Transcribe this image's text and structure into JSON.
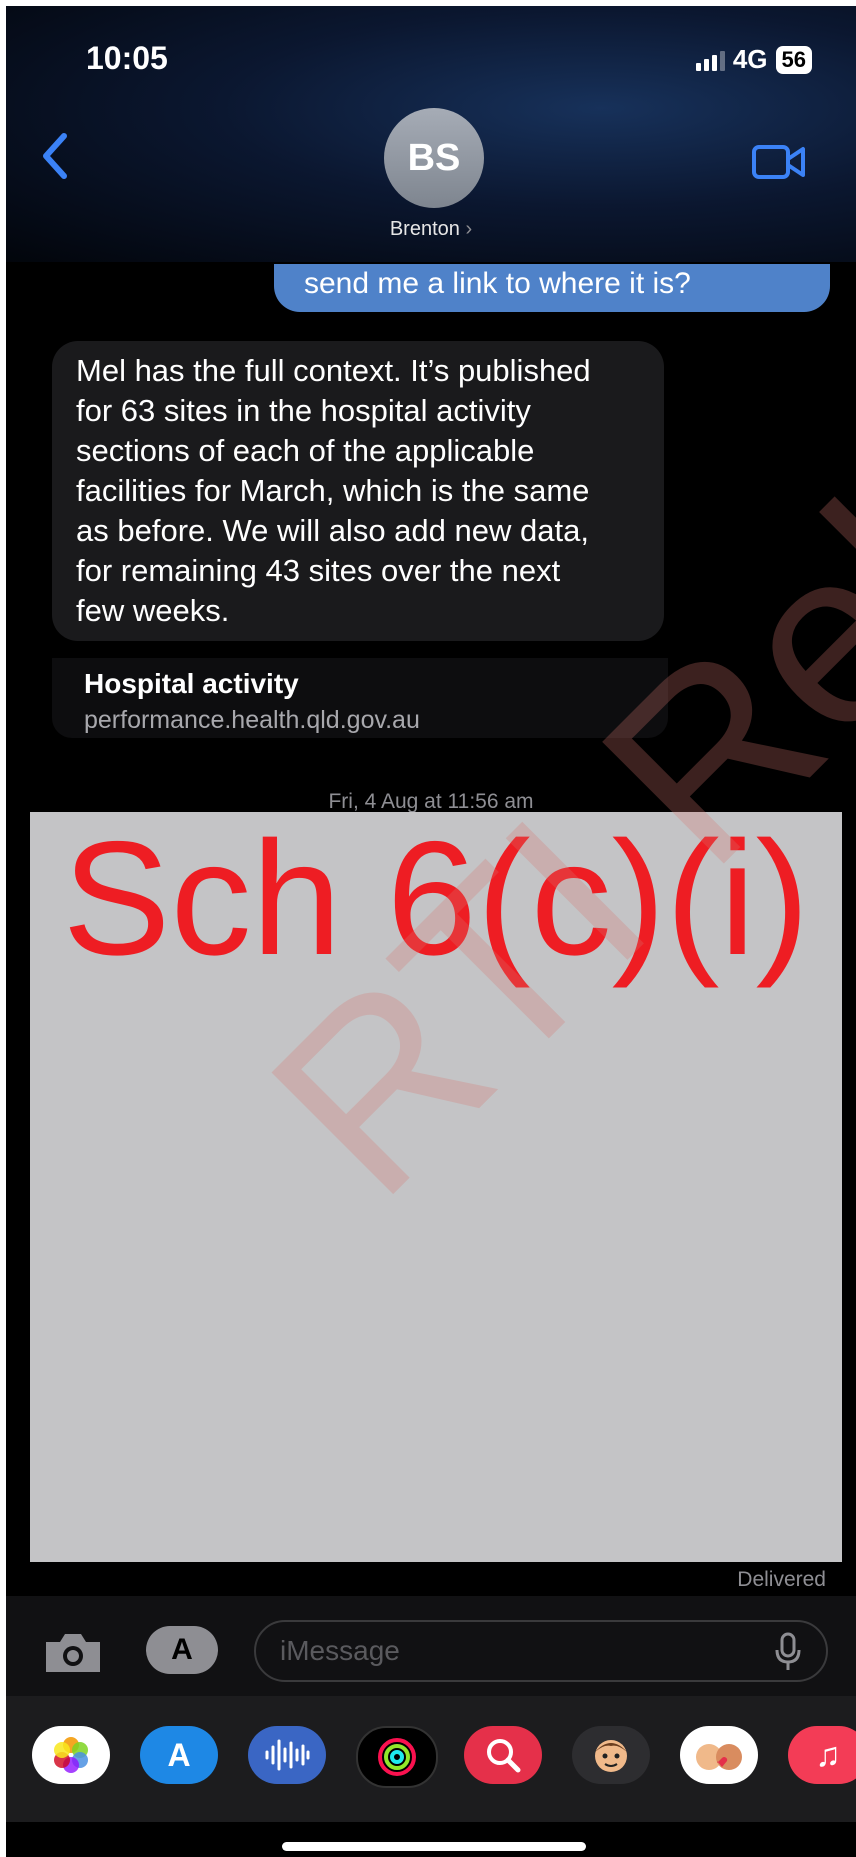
{
  "status": {
    "time": "10:05",
    "network": "4G",
    "battery": "56"
  },
  "header": {
    "avatar_initials": "BS",
    "contact_name": "Brenton",
    "back_icon": "chevron-left-icon",
    "video_icon": "video-camera-icon"
  },
  "conversation": {
    "outgoing_text": "send me a link to where it is?",
    "incoming_lines": [
      "Mel has the full context. It’s published",
      "for 63 sites in the hospital activity",
      "sections of each of the applicable",
      "facilities for March, which is the same",
      "as before. We will also add new data,",
      "for remaining 43 sites over the next",
      "few weeks."
    ],
    "link_title": "Hospital activity",
    "link_url": "performance.health.qld.gov.au",
    "timestamp": "Fri, 4 Aug at 11:56 am",
    "redaction_label": "Sch 6(c)(i)",
    "watermark": "RTI Rele",
    "status": "Delivered"
  },
  "compose": {
    "placeholder": "iMessage",
    "camera_icon": "camera-icon",
    "apps_icon": "app-store-icon",
    "mic_icon": "microphone-icon"
  },
  "app_tray": [
    "photos-icon",
    "app-store-icon",
    "audio-icon",
    "activity-icon",
    "search-images-icon",
    "memoji-icon",
    "memoji-stickers-icon",
    "music-icon"
  ],
  "colors": {
    "accent": "#4f82c9",
    "redaction": "#c4c4c6",
    "redaction_text": "#ee1d23"
  }
}
